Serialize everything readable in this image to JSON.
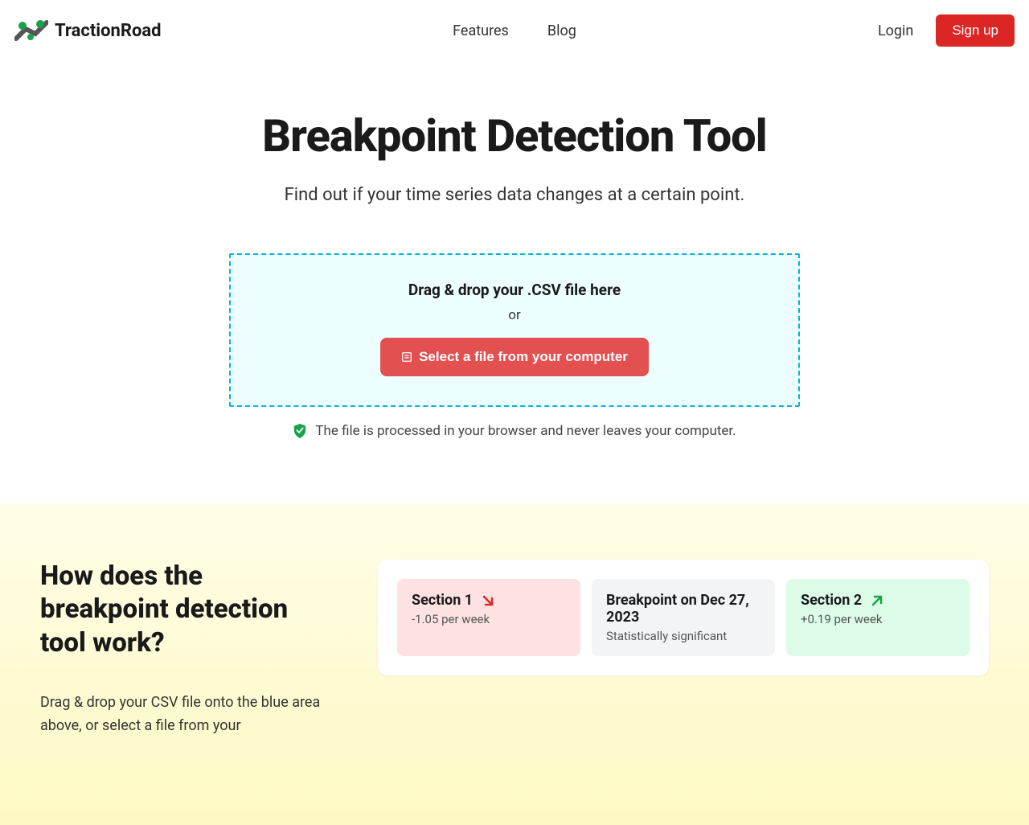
{
  "header": {
    "brand": "TractionRoad",
    "nav": {
      "features": "Features",
      "blog": "Blog"
    },
    "login": "Login",
    "signup": "Sign up"
  },
  "hero": {
    "title": "Breakpoint Detection Tool",
    "subtitle": "Find out if your time series data changes at a certain point."
  },
  "dropzone": {
    "title": "Drag & drop your .CSV file here",
    "or": "or",
    "button": "Select a file from your computer",
    "privacy": "The file is processed in your browser and never leaves your computer."
  },
  "howItWorks": {
    "heading": "How does the breakpoint detection tool work?",
    "body": "Drag & drop your CSV file onto the blue area above, or select a file from your"
  },
  "resultCards": {
    "section1": {
      "title": "Section 1",
      "subtitle": "-1.05 per week"
    },
    "breakpoint": {
      "title": "Breakpoint on Dec 27, 2023",
      "subtitle": "Statistically significant"
    },
    "section2": {
      "title": "Section 2",
      "subtitle": "+0.19 per week"
    }
  }
}
